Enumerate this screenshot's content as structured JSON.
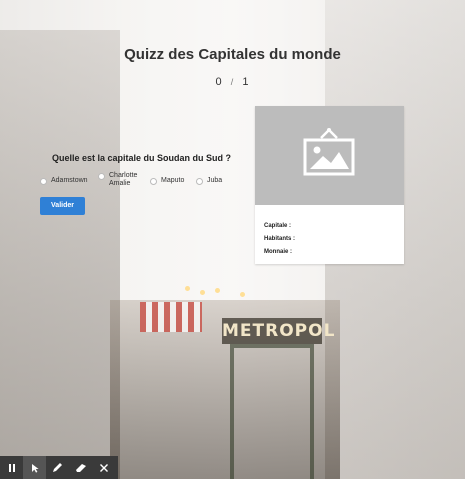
{
  "quiz": {
    "title": "Quizz des Capitales du monde",
    "score_current": "0",
    "score_separator": "/",
    "score_total": "1",
    "question": "Quelle est la capitale du Soudan du Sud ?",
    "options": [
      {
        "label_line1": "Adamstown",
        "label_line2": ""
      },
      {
        "label_line1": "Charlotte",
        "label_line2": "Amalie"
      },
      {
        "label_line1": "Maputo",
        "label_line2": ""
      },
      {
        "label_line1": "Juba",
        "label_line2": ""
      }
    ],
    "submit_label": "Valider"
  },
  "info_card": {
    "image_icon": "image-placeholder-icon",
    "capital_label": "Capitale :",
    "population_label": "Habitants :",
    "currency_label": "Monnaie :"
  },
  "background": {
    "sign_text": "METROPOL"
  },
  "toolbar": {
    "icons": [
      "pause-icon",
      "pointer-icon",
      "pen-icon",
      "eraser-icon",
      "close-icon"
    ]
  },
  "colors": {
    "accent": "#2f80d6",
    "toolbar_bg": "#3a3a3a",
    "image_placeholder": "#bcbcbc"
  }
}
